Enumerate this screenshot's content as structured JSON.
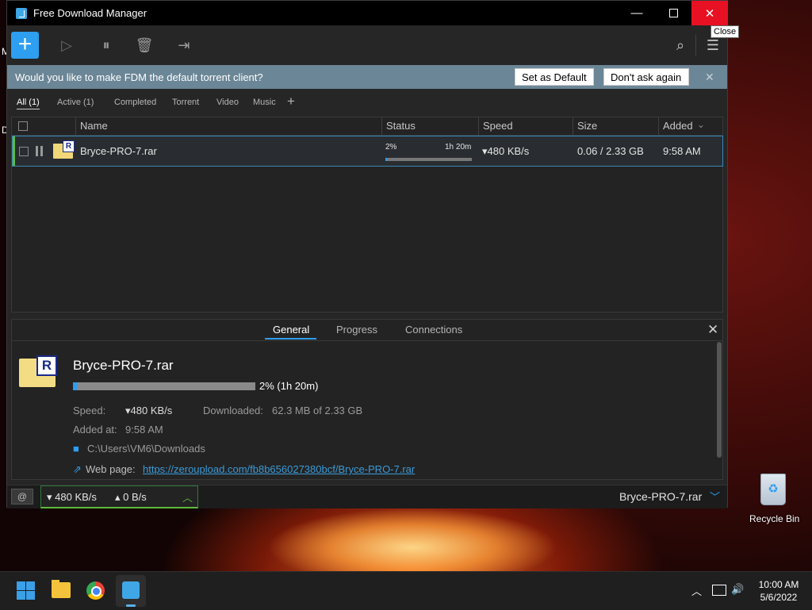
{
  "window": {
    "title": "Free Download Manager",
    "tooltip": "Close",
    "controls": {
      "minimize": "—",
      "maximize": "",
      "close": "✕"
    }
  },
  "toolbar": {
    "add": "+",
    "play": "▷",
    "pause": "⏸",
    "delete": "🗑",
    "move": "⇥",
    "search": "⌕",
    "menu": "☰"
  },
  "banner": {
    "text": "Would you like to make FDM the default torrent client?",
    "set_default": "Set as Default",
    "dont_ask": "Don't ask again",
    "close": "✕"
  },
  "filters": [
    {
      "label": "All (1)",
      "active": true
    },
    {
      "label": "Active (1)",
      "active": false
    },
    {
      "label": "Completed",
      "active": false
    },
    {
      "label": "Torrent",
      "active": false
    },
    {
      "label": "Video",
      "active": false
    },
    {
      "label": "Music",
      "active": false
    }
  ],
  "filter_add": "+",
  "table": {
    "headers": {
      "name": "Name",
      "status": "Status",
      "speed": "Speed",
      "size": "Size",
      "added": "Added"
    },
    "sort_indicator": "⌄",
    "rows": [
      {
        "name": "Bryce-PRO-7.rar",
        "status_percent": "2%",
        "status_time": "1h 20m",
        "progress_fraction": 0.02,
        "speed": "▾480 KB/s",
        "size": "0.06 / 2.33 GB",
        "added": "9:58 AM",
        "badge": "R"
      }
    ]
  },
  "details": {
    "tabs": [
      "General",
      "Progress",
      "Connections"
    ],
    "close": "✕",
    "file_name": "Bryce-PRO-7.rar",
    "badge": "R",
    "progress_fraction": 0.02,
    "progress_text": "2% (1h 20m)",
    "speed_label": "Speed:",
    "speed_value": "▾480 KB/s",
    "downloaded_label": "Downloaded:",
    "downloaded_value": "62.3 MB of 2.33 GB",
    "added_label": "Added at:",
    "added_value": "9:58 AM",
    "folder": "C:\\Users\\VM6\\Downloads",
    "webpage_label": "Web page:",
    "webpage_url": "https://zeroupload.com/fb8b656027380bcf/Bryce-PRO-7.rar"
  },
  "statusbar": {
    "down": "▾ 480 KB/s",
    "up": "▴ 0 B/s",
    "file": "Bryce-PRO-7.rar"
  },
  "desktop": {
    "recycle_bin": "Recycle Bin",
    "edge_letters": [
      "M",
      "D"
    ]
  },
  "taskbar": {
    "time": "10:00 AM",
    "date": "5/6/2022"
  },
  "colors": {
    "accent": "#2d9ef0",
    "close_red": "#e81123",
    "active_green": "#5dbb3e",
    "banner": "#6b8696"
  }
}
